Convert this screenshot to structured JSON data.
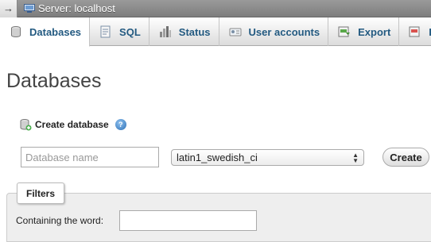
{
  "topbar": {
    "collapse_glyph": "→",
    "server_label": "Server: localhost",
    "server_icon": "server-icon"
  },
  "tabs": [
    {
      "label": "Databases",
      "icon": "database-icon",
      "active": true
    },
    {
      "label": "SQL",
      "icon": "sql-icon",
      "active": false
    },
    {
      "label": "Status",
      "icon": "status-icon",
      "active": false
    },
    {
      "label": "User accounts",
      "icon": "user-accounts-icon",
      "active": false
    },
    {
      "label": "Export",
      "icon": "export-icon",
      "active": false
    },
    {
      "label": "I",
      "icon": "import-icon",
      "active": false
    }
  ],
  "page": {
    "title": "Databases"
  },
  "create_database": {
    "label": "Create database",
    "help_glyph": "?",
    "name_placeholder": "Database name",
    "name_value": "",
    "collation_value": "latin1_swedish_ci",
    "create_button": "Create"
  },
  "filters": {
    "legend": "Filters",
    "containing_label": "Containing the word:",
    "containing_value": ""
  },
  "colors": {
    "tab_text": "#235a81",
    "topbar": "#8a8a8a",
    "help_icon": "#2d6fb5"
  }
}
